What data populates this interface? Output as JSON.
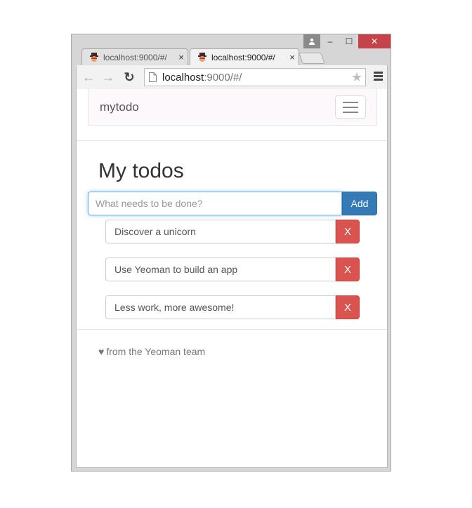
{
  "window": {
    "controls": {
      "minimize": "–",
      "maximize": "☐",
      "close": "✕"
    }
  },
  "tabs": [
    {
      "title": "localhost:9000/#/",
      "close": "×",
      "active": false
    },
    {
      "title": "localhost:9000/#/",
      "close": "×",
      "active": true
    }
  ],
  "toolbar": {
    "url_host": "localhost",
    "url_path": ":9000/#/",
    "back_icon": "←",
    "forward_icon": "→",
    "reload_icon": "↻",
    "star_icon": "★"
  },
  "app": {
    "brand": "mytodo",
    "title": "My todos",
    "input_placeholder": "What needs to be done?",
    "input_value": "",
    "add_label": "Add",
    "todos": [
      {
        "text": "Discover a unicorn",
        "delete_label": "X"
      },
      {
        "text": "Use Yeoman to build an app",
        "delete_label": "X"
      },
      {
        "text": "Less work, more awesome!",
        "delete_label": "X"
      }
    ],
    "footer_text": "from the Yeoman team",
    "heart_icon": "♥"
  },
  "colors": {
    "primary": "#337ab7",
    "danger": "#d9534f",
    "window_close": "#c7434a",
    "navbar_bg": "#fdf8fc"
  }
}
